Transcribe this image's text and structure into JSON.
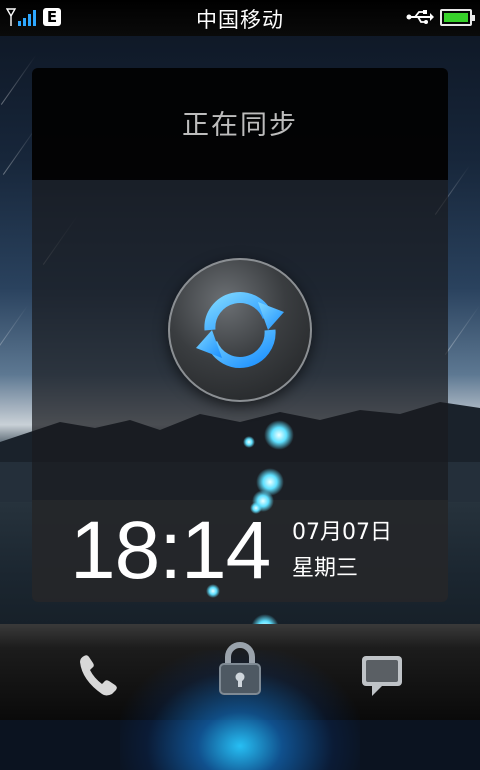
{
  "status_bar": {
    "carrier": "中国移动",
    "network_type": "E",
    "icons": [
      "signal-icon",
      "usb-icon",
      "battery-icon"
    ],
    "battery_color": "#37d12a"
  },
  "sync_panel": {
    "title": "正在同步",
    "icon": "sync-icon",
    "accent_color": "#36b6ff"
  },
  "clock": {
    "time": "18:14",
    "date": "07月07日",
    "weekday": "星期三"
  },
  "dock": {
    "items": [
      "phone-icon",
      "lock-icon",
      "message-icon"
    ]
  }
}
